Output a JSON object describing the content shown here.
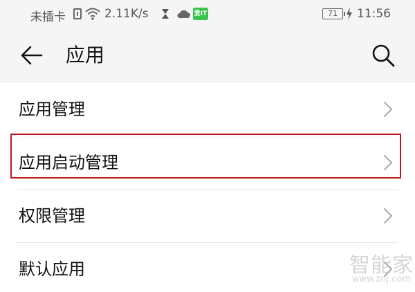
{
  "status_bar": {
    "carrier": "未插卡",
    "speed": "2.11K/s",
    "app_badge": "爱IT",
    "battery": "71",
    "time": "11:56"
  },
  "app_bar": {
    "title": "应用",
    "back_icon": "arrow-left-icon",
    "search_icon": "search-icon"
  },
  "list": {
    "items": [
      {
        "label": "应用管理"
      },
      {
        "label": "应用启动管理",
        "highlighted": true
      },
      {
        "label": "权限管理"
      },
      {
        "label": "默认应用"
      }
    ]
  },
  "watermark": {
    "text": "智能家",
    "url": "www.znj.com"
  },
  "colors": {
    "highlight": "#c8161d",
    "background": "#ffffff",
    "header_bg": "#f5f5f5"
  }
}
